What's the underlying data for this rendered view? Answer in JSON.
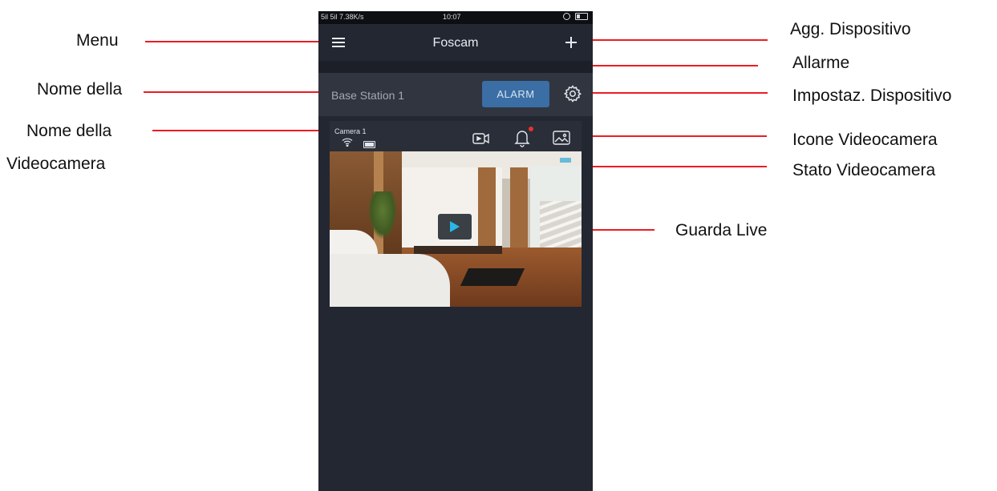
{
  "statusbar": {
    "signal": "̇̇̇ 7.38K/s",
    "left_text": "5il 5il 7.38K/s",
    "time": "10:07"
  },
  "app": {
    "title": "Foscam"
  },
  "base_station": {
    "name": "Base Station 1",
    "alarm_label": "ALARM"
  },
  "camera": {
    "name": "Camera 1"
  },
  "callouts": {
    "menu": "Menu",
    "base_name": "Nome della",
    "camera_name_1": "Nome della",
    "camera_name_2": "Videocamera",
    "add_device": "Agg. Dispositivo",
    "alarm": "Allarme",
    "device_settings": "Impostaz. Dispositivo",
    "camera_icons": "Icone Videocamera",
    "camera_status": "Stato Videocamera",
    "live_view": "Guarda Live"
  },
  "colors": {
    "callout_line": "#ec1c24",
    "alarm_button": "#3a6ea4",
    "notification_dot": "#e8332f",
    "status_badge": "#4fb1d8"
  },
  "icons": [
    "menu-icon",
    "add-icon",
    "gear-icon",
    "wifi-icon",
    "battery-icon",
    "record-icon",
    "bell-icon",
    "snapshot-icon",
    "play-icon"
  ]
}
